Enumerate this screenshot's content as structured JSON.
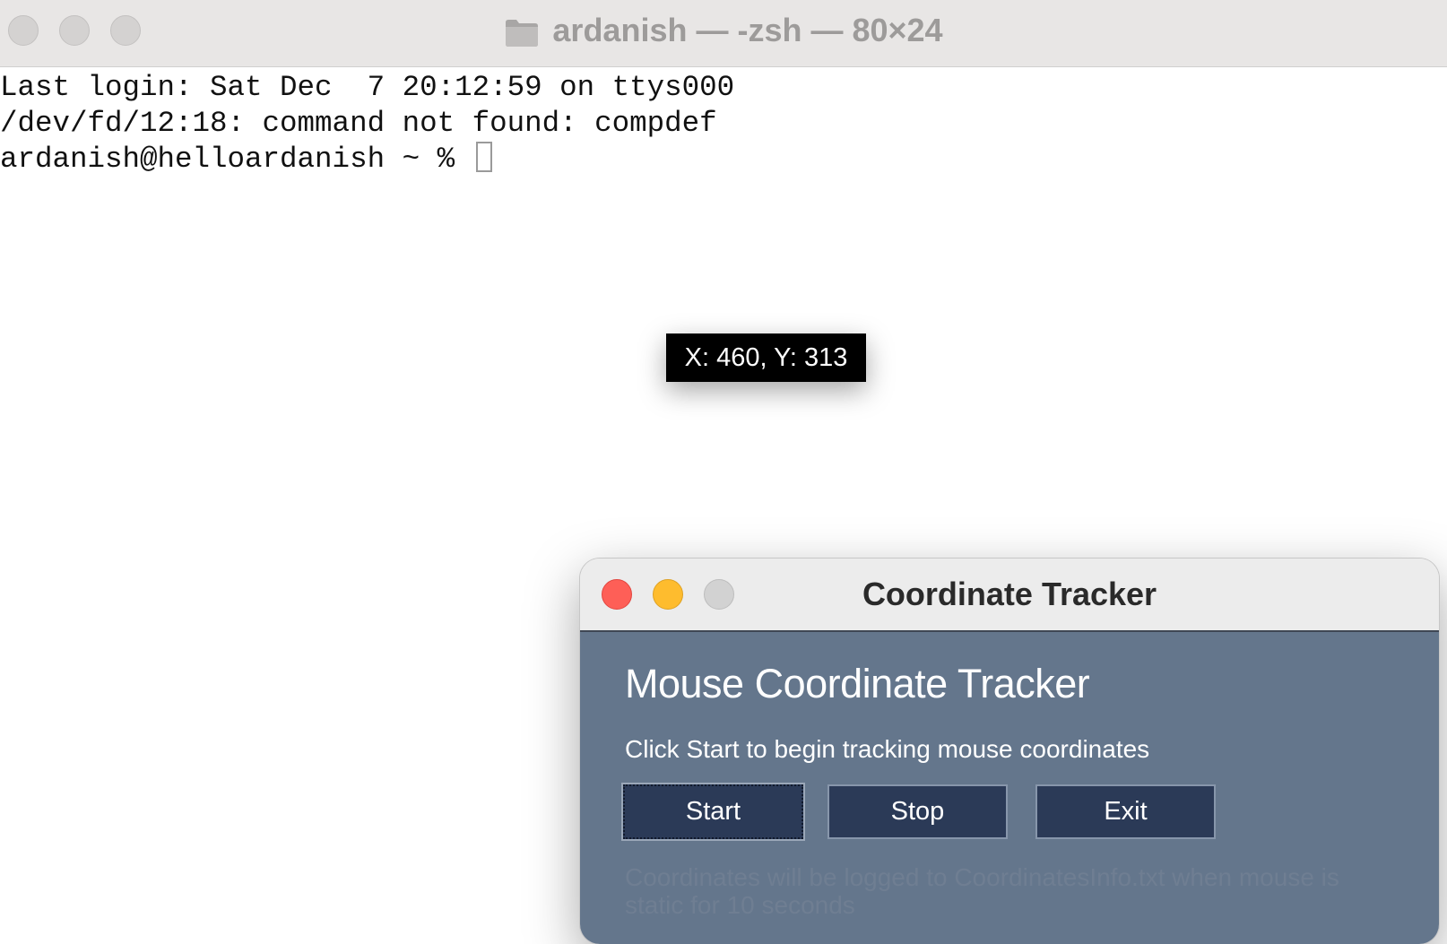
{
  "terminal": {
    "title": "ardanish — -zsh — 80×24",
    "lines": [
      "Last login: Sat Dec  7 20:12:59 on ttys000",
      "/dev/fd/12:18: command not found: compdef",
      "ardanish@helloardanish ~ % "
    ]
  },
  "tooltip": {
    "text": "X: 460, Y: 313"
  },
  "tracker": {
    "window_title": "Coordinate Tracker",
    "heading": "Mouse Coordinate Tracker",
    "instructions": "Click Start to begin tracking mouse coordinates",
    "buttons": {
      "start": "Start",
      "stop": "Stop",
      "exit": "Exit"
    },
    "footer": "Coordinates will be logged to CoordinatesInfo.txt when mouse is static for 10 seconds",
    "colors": {
      "body": "#64768c",
      "button": "#2b3a57",
      "close": "#fe5f57",
      "minimize": "#febc2e",
      "zoom": "#d2d2d2"
    }
  }
}
